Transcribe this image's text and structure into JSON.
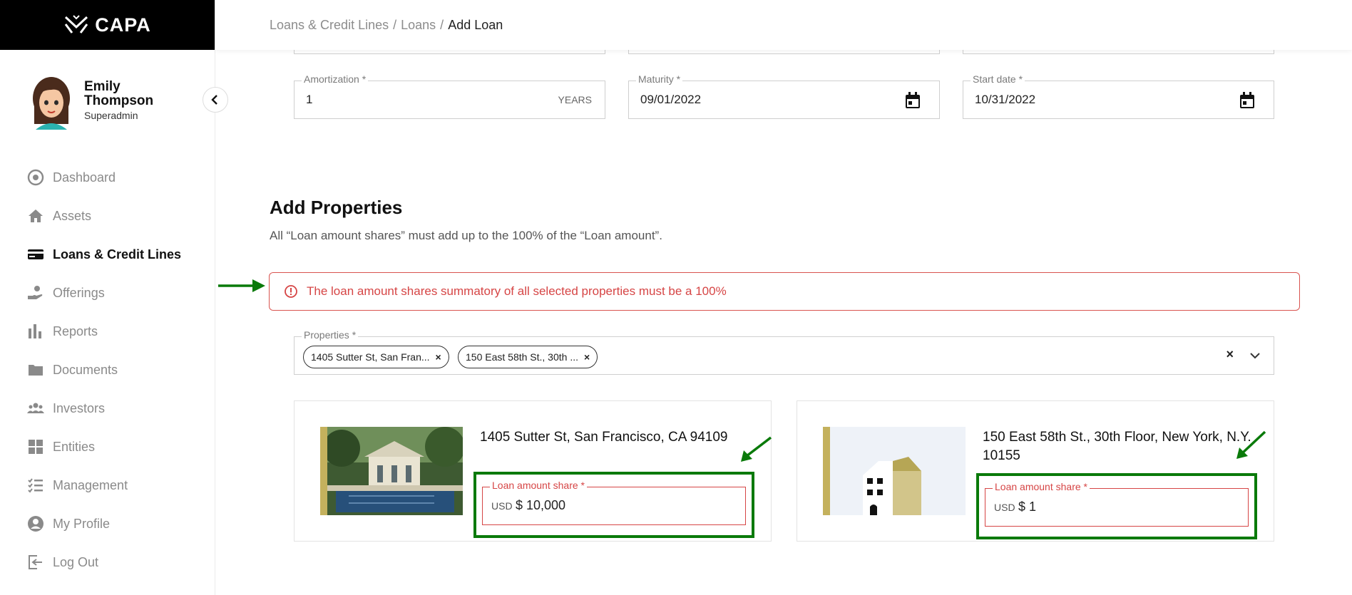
{
  "brand": {
    "name": "CAPA"
  },
  "user": {
    "first_name": "Emily",
    "last_name": "Thompson",
    "role": "Superadmin"
  },
  "nav": [
    {
      "label": "Dashboard",
      "icon": "dashboard-icon",
      "active": false
    },
    {
      "label": "Assets",
      "icon": "home-icon",
      "active": false
    },
    {
      "label": "Loans & Credit Lines",
      "icon": "credit-card-icon",
      "active": true
    },
    {
      "label": "Offerings",
      "icon": "hand-money-icon",
      "active": false
    },
    {
      "label": "Reports",
      "icon": "bar-chart-icon",
      "active": false
    },
    {
      "label": "Documents",
      "icon": "folder-icon",
      "active": false
    },
    {
      "label": "Investors",
      "icon": "users-icon",
      "active": false
    },
    {
      "label": "Entities",
      "icon": "grid-icon",
      "active": false
    },
    {
      "label": "Management",
      "icon": "checklist-icon",
      "active": false
    },
    {
      "label": "My Profile",
      "icon": "user-circle-icon",
      "active": false
    },
    {
      "label": "Log Out",
      "icon": "logout-icon",
      "active": false
    }
  ],
  "breadcrumb": {
    "items": [
      "Loans & Credit Lines",
      "Loans"
    ],
    "current": "Add Loan"
  },
  "form": {
    "amortization": {
      "label": "Amortization *",
      "value": "1",
      "suffix": "YEARS"
    },
    "maturity": {
      "label": "Maturity *",
      "value": "09/01/2022"
    },
    "start_date": {
      "label": "Start date *",
      "value": "10/31/2022"
    }
  },
  "properties_section": {
    "title": "Add Properties",
    "description": "All “Loan amount shares” must add up to the 100% of the “Loan amount”.",
    "error": "The loan amount shares summatory of all selected properties must be a 100%",
    "select_label": "Properties *",
    "chips": [
      "1405 Sutter St, San Fran...",
      "150 East 58th St., 30th ..."
    ],
    "clear_symbol": "×"
  },
  "cards": [
    {
      "title": "1405 Sutter St, San Francisco, CA 94109",
      "share_label": "Loan amount share *",
      "currency": "USD",
      "value": "$ 10,000"
    },
    {
      "title": "150 East 58th St., 30th Floor, New York, N.Y. 10155",
      "share_label": "Loan amount share *",
      "currency": "USD",
      "value": "$ 1"
    }
  ],
  "colors": {
    "error": "#d64545",
    "annotation": "#0a7a0a",
    "sidebar_header": "#000000",
    "accent_gold": "#c4b15d"
  }
}
